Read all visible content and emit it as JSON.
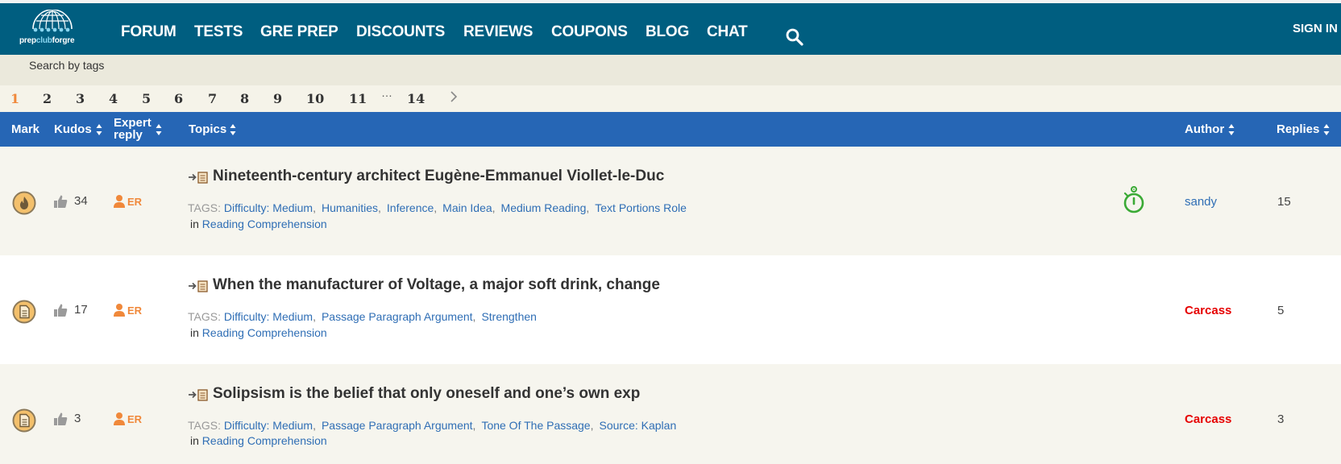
{
  "logo": {
    "part1": "prep",
    "part2": "club",
    "part3": "forgre"
  },
  "nav": {
    "items": [
      {
        "label": "FORUM"
      },
      {
        "label": "TESTS"
      },
      {
        "label": "GRE PREP"
      },
      {
        "label": "DISCOUNTS"
      },
      {
        "label": "REVIEWS"
      },
      {
        "label": "COUPONS"
      },
      {
        "label": "BLOG"
      },
      {
        "label": "CHAT"
      }
    ],
    "search_icon": "search-icon",
    "signin": "SIGN IN"
  },
  "tag_search": {
    "label": "Search by tags"
  },
  "pagination": {
    "pages": [
      "1",
      "2",
      "3",
      "4",
      "5",
      "6",
      "7",
      "8",
      "9",
      "10",
      "11",
      "…",
      "14"
    ],
    "current": "1",
    "next_icon": "chevron-right-icon"
  },
  "table": {
    "headers": {
      "mark": "Mark",
      "kudos": "Kudos",
      "expert_line1": "Expert",
      "expert_line2": "reply",
      "topics": "Topics",
      "author": "Author",
      "replies": "Replies"
    },
    "tags_label": "TAGS:",
    "in_label": "in",
    "rows": [
      {
        "mark_icon": "flame-icon",
        "kudos": "34",
        "er": "ER",
        "title": "Nineteenth-century architect Eugène-Emmanuel Viollet-le-Duc",
        "tags": [
          "Difficulty: Medium",
          "Humanities",
          "Inference",
          "Main Idea",
          "Medium Reading",
          "Text Portions Role"
        ],
        "forum": "Reading Comprehension",
        "timer_icon": "stopwatch-icon",
        "author": "sandy",
        "author_style": "normal",
        "replies": "15"
      },
      {
        "mark_icon": "document-icon",
        "kudos": "17",
        "er": "ER",
        "title": "When the manufacturer of Voltage, a major soft drink, change",
        "tags": [
          "Difficulty: Medium",
          "Passage Paragraph Argument",
          "Strengthen"
        ],
        "forum": "Reading Comprehension",
        "author": "Carcass",
        "author_style": "moderator",
        "replies": "5"
      },
      {
        "mark_icon": "document-icon",
        "kudos": "3",
        "er": "ER",
        "title": "Solipsism is the belief that only oneself and one’s own exp",
        "tags": [
          "Difficulty: Medium",
          "Passage Paragraph Argument",
          "Tone Of The Passage",
          "Source: Kaplan"
        ],
        "forum": "Reading Comprehension",
        "author": "Carcass",
        "author_style": "moderator",
        "replies": "3"
      }
    ]
  },
  "colors": {
    "nav_bg": "#005e80",
    "table_header_bg": "#2666b5",
    "link": "#2f6eb5",
    "moderator": "#e60000",
    "accent": "#f0883a",
    "timer": "#3aaa35"
  }
}
